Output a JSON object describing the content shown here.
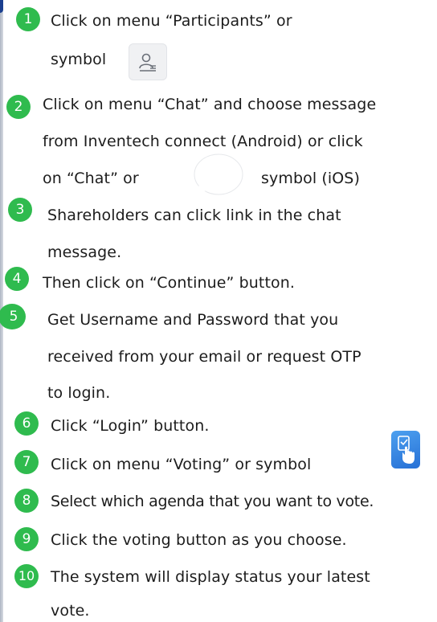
{
  "steps": [
    {
      "number": "1",
      "lines": [
        "Click on menu “Participants” or",
        "symbol"
      ]
    },
    {
      "number": "2",
      "lines": [
        "Click on menu “Chat” and choose message",
        "from Inventech connect (Android) or click",
        "on “Chat” or",
        "symbol (iOS)"
      ]
    },
    {
      "number": "3",
      "lines": [
        "Shareholders can click link in the chat",
        "message."
      ]
    },
    {
      "number": "4",
      "lines": [
        "Then click on “Continue” button."
      ]
    },
    {
      "number": "5",
      "lines": [
        "Get Username and Password that you",
        "received from your email or request OTP",
        "to login."
      ]
    },
    {
      "number": "6",
      "lines": [
        "Click “Login” button."
      ]
    },
    {
      "number": "7",
      "lines": [
        "Click on menu “Voting” or symbol"
      ]
    },
    {
      "number": "8",
      "lines": [
        "Select which agenda that you want to vote."
      ]
    },
    {
      "number": "9",
      "lines": [
        "Click the voting button as you choose."
      ]
    },
    {
      "number": "10",
      "lines": [
        "The system will display status your latest",
        "vote."
      ]
    }
  ],
  "icons": {
    "participants": "participants-icon",
    "chat": "chat-bubble-icon",
    "voting": "voting-icon"
  },
  "colors": {
    "badge": "#2fbb4e",
    "voting_icon": "#2f7fe0",
    "text": "#1c1c1c"
  }
}
